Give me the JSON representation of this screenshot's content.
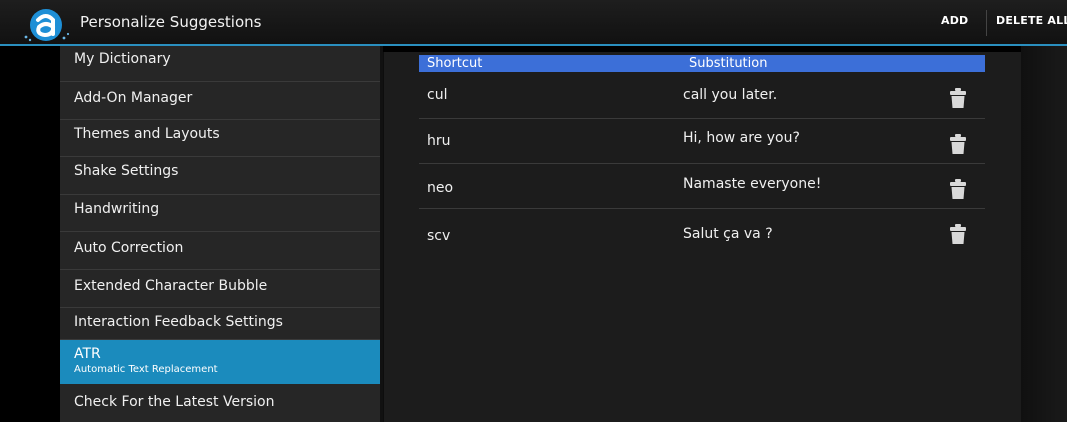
{
  "app": {
    "title": "Personalize Suggestions",
    "icon": "app-logo-icon",
    "accent_color": "#2a8fbf"
  },
  "actions": {
    "add_label": "ADD",
    "delete_all_label": "DELETE ALL"
  },
  "sidebar": {
    "items": [
      {
        "label": "My Dictionary"
      },
      {
        "label": "Add-On Manager"
      },
      {
        "label": "Themes and Layouts"
      },
      {
        "label": "Shake Settings"
      },
      {
        "label": "Handwriting"
      },
      {
        "label": "Auto Correction"
      },
      {
        "label": "Extended Character Bubble"
      },
      {
        "label": "Interaction Feedback Settings"
      },
      {
        "label": "ATR",
        "sublabel": "Automatic Text Replacement",
        "selected": true
      },
      {
        "label": "Check For the Latest Version"
      }
    ],
    "selected_color": "#1b8bbd"
  },
  "table": {
    "headers": {
      "shortcut": "Shortcut",
      "substitution": "Substitution"
    },
    "header_color": "#3c6fd8",
    "rows": [
      {
        "shortcut": "cul",
        "substitution": "call you later.",
        "action_icon": "trash-icon"
      },
      {
        "shortcut": "hru",
        "substitution": "Hi, how are you?",
        "action_icon": "trash-icon"
      },
      {
        "shortcut": "neo",
        "substitution": "Namaste everyone!",
        "action_icon": "trash-icon"
      },
      {
        "shortcut": "scv",
        "substitution": "Salut ça va ?",
        "action_icon": "trash-icon"
      }
    ]
  }
}
